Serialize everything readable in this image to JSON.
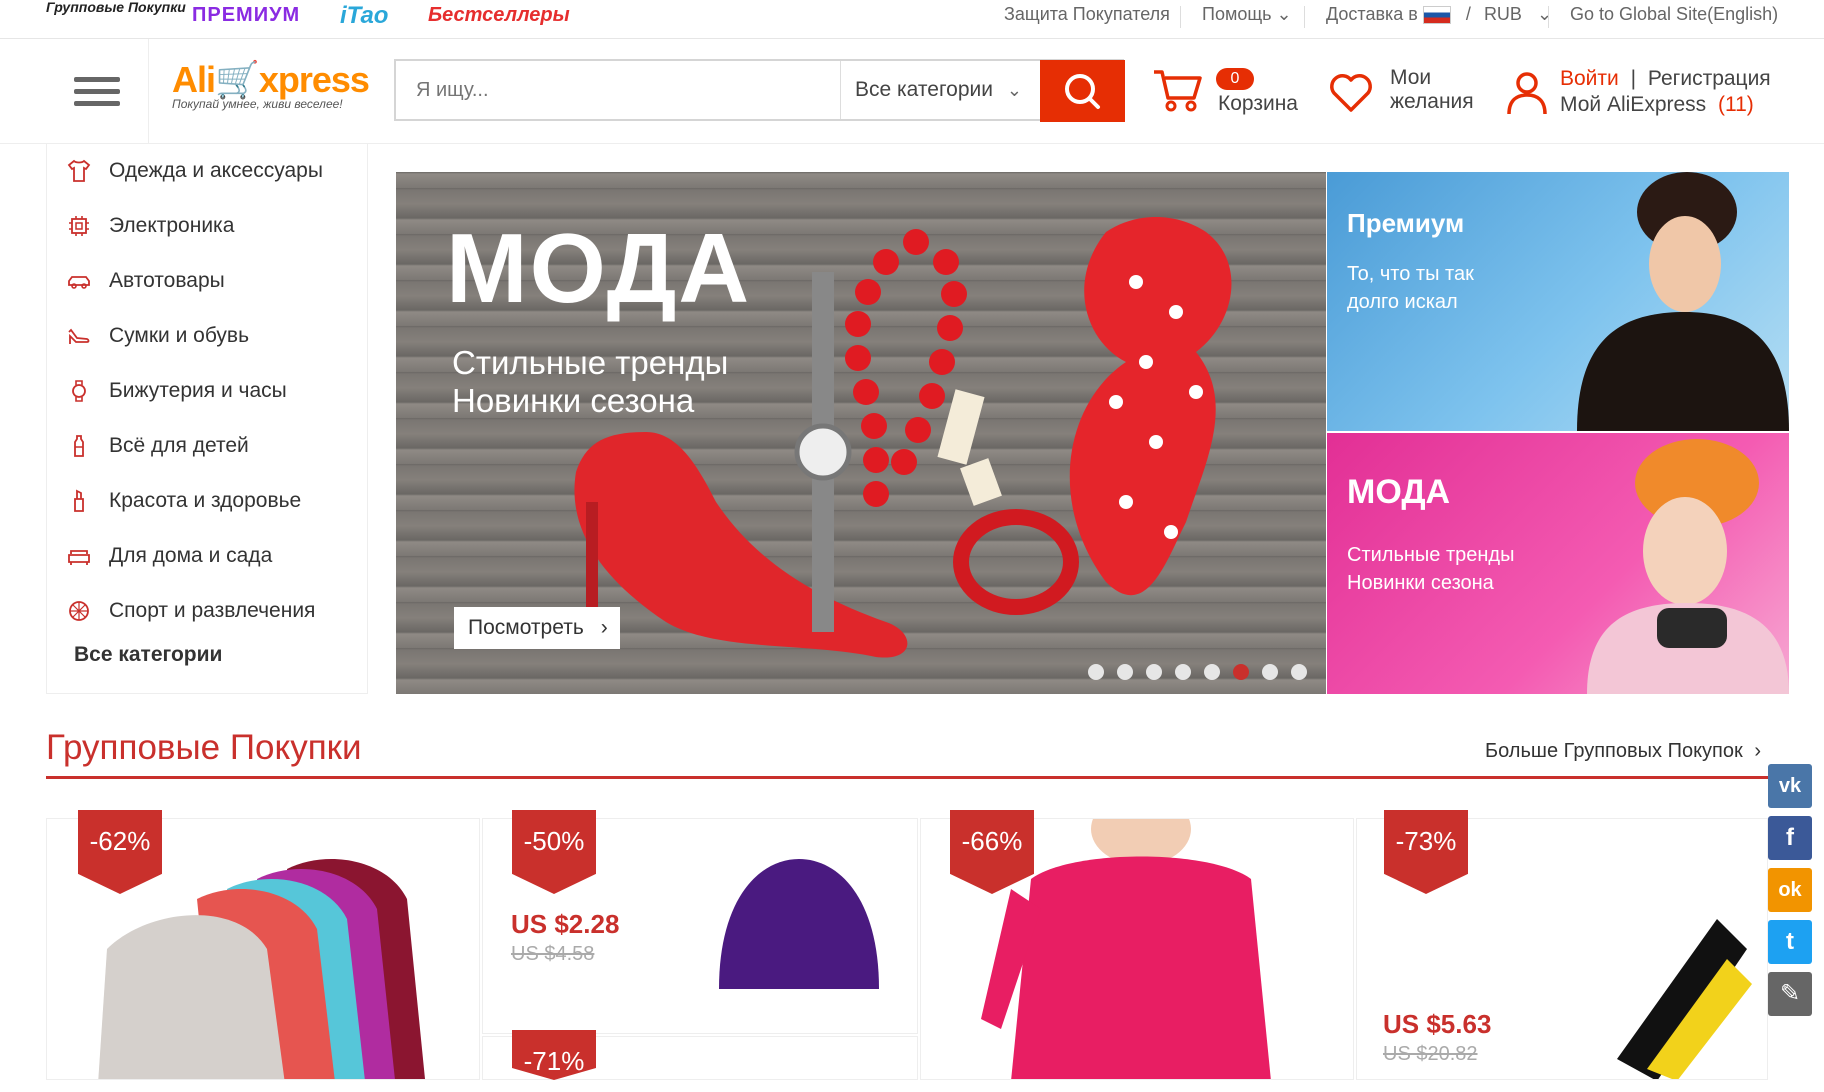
{
  "topbar": {
    "group_buy": "Групповые Покупки",
    "premium": "ПРЕМИУМ",
    "itao": "iTao",
    "bestsellers": "Бестселлеры",
    "buyer_protection": "Защита Покупателя",
    "help": "Помощь",
    "delivery": "Доставка в",
    "currency_sep": "/",
    "currency": "RUB",
    "global_site": "Go to Global Site(English)"
  },
  "header": {
    "logo_main": "AliExpress",
    "logo_tagline": "Покупай умнее, живи веселее!",
    "search_placeholder": "Я ищу...",
    "category_select": "Все категории",
    "cart_count": "0",
    "cart_label": "Корзина",
    "wishlist_line1": "Мои",
    "wishlist_line2": "желания",
    "login": "Войти",
    "divider": "|",
    "register": "Регистрация",
    "my_aliexpress": "Мой AliExpress",
    "my_count": "(11)"
  },
  "sidebar": {
    "items": [
      {
        "label": "Одежда и аксессуары",
        "icon": "shirt-icon"
      },
      {
        "label": "Электроника",
        "icon": "chip-icon"
      },
      {
        "label": "Автотовары",
        "icon": "car-icon"
      },
      {
        "label": "Сумки и обувь",
        "icon": "shoe-icon"
      },
      {
        "label": "Бижутерия и часы",
        "icon": "watch-icon"
      },
      {
        "label": "Всё для детей",
        "icon": "bottle-icon"
      },
      {
        "label": "Красота и здоровье",
        "icon": "lipstick-icon"
      },
      {
        "label": "Для дома и сада",
        "icon": "sofa-icon"
      },
      {
        "label": "Спорт и развлечения",
        "icon": "ball-icon"
      }
    ],
    "all_categories": "Все категории"
  },
  "hero": {
    "title": "МОДА",
    "subtitle_line1": "Стильные тренды",
    "subtitle_line2": "Новинки сезона",
    "cta": "Посмотреть",
    "dot_count": 8,
    "active_dot": 6
  },
  "promos": [
    {
      "title": "Премиум",
      "line1": "То, что ты так",
      "line2": "долго искал"
    },
    {
      "title": "МОДА",
      "line1": "Стильные тренды",
      "line2": "Новинки сезона"
    }
  ],
  "group_buys": {
    "title": "Групповые Покупки",
    "more": "Больше Групповых Покупок",
    "products": [
      {
        "discount": "-62%"
      },
      {
        "discount": "-50%",
        "price": "US $2.28",
        "old_price": "US $4.58"
      },
      {
        "discount": "-71%"
      },
      {
        "discount": "-66%"
      },
      {
        "discount": "-73%",
        "price": "US $5.63",
        "old_price": "US $20.82"
      }
    ]
  },
  "social": {
    "vk": "vk",
    "facebook": "f",
    "odnoklassniki": "ok",
    "twitter": "t"
  },
  "colors": {
    "accent": "#e62e04",
    "section_red": "#c9302c",
    "promo_blue": "#4a9bd6",
    "promo_pink": "#e22f95"
  }
}
